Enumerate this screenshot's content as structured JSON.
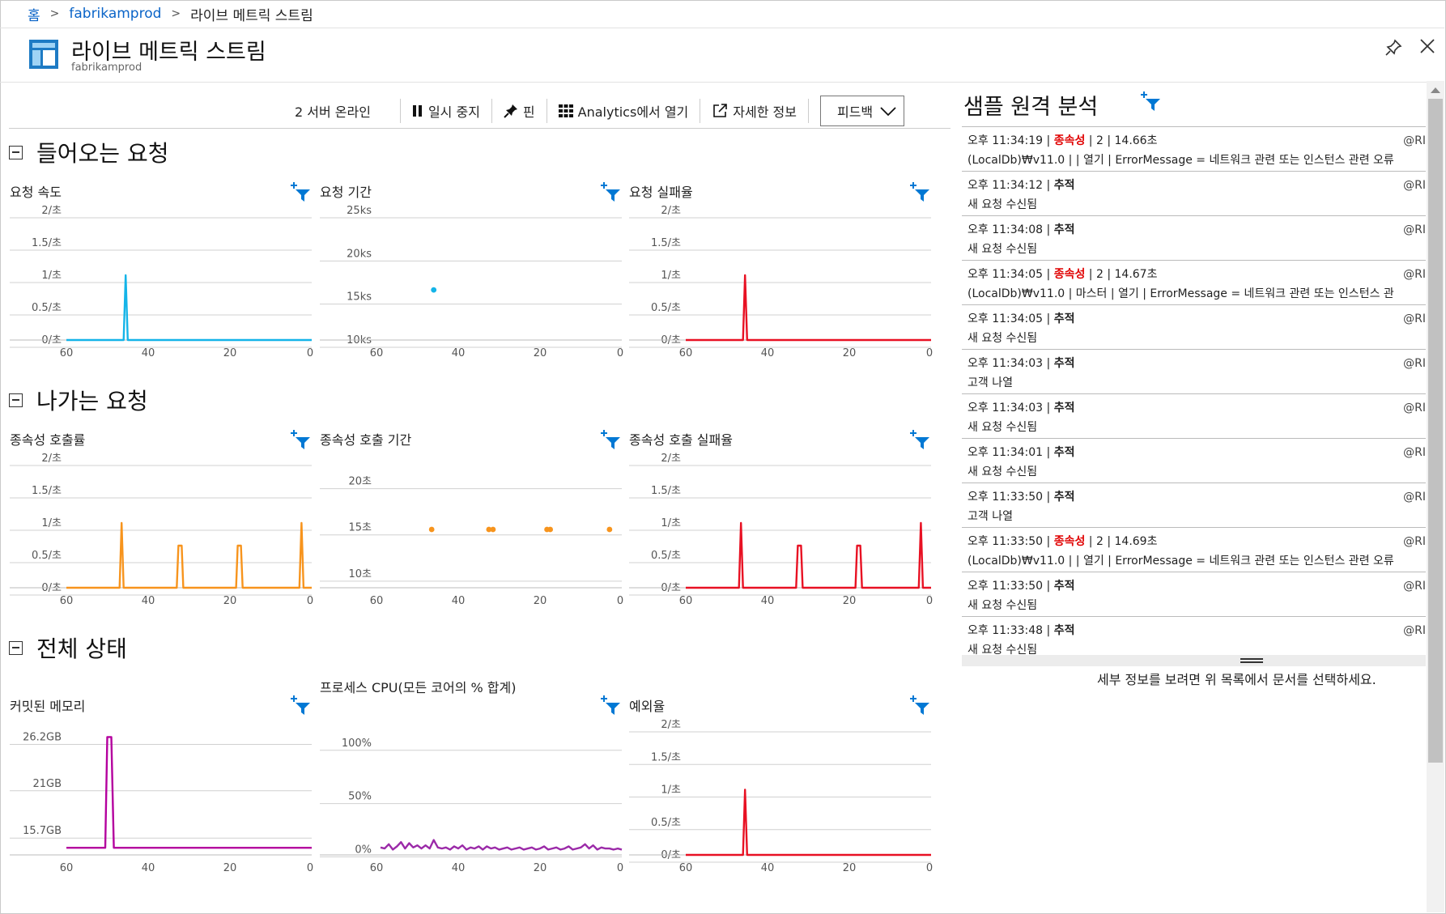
{
  "breadcrumb": {
    "home": "홈",
    "resource": "fabrikamprod",
    "current": "라이브 메트릭 스트림"
  },
  "header": {
    "title": "라이브 메트릭 스트림",
    "subtitle": "fabrikamprod"
  },
  "toolbar": {
    "servers": "2 서버 온라인",
    "pause": "일시 중지",
    "pin": "핀",
    "analytics": "Analytics에서 열기",
    "details": "자세한 정보",
    "feedback": "피드백"
  },
  "sections": {
    "incoming": "들어오는 요청",
    "outgoing": "나가는 요청",
    "overall": "전체 상태"
  },
  "colors": {
    "blue": "#14b4e8",
    "red": "#e81123",
    "orange": "#f7941d",
    "magenta": "#b4009e",
    "purple": "#9b2aa8",
    "link": "#0a64c8",
    "filter_icon": "#0078d4"
  },
  "chart_data": [
    {
      "id": "req-rate",
      "type": "line",
      "title": "요청 속도",
      "xlabel": "",
      "ylabel": "",
      "x_ticks": [
        "60",
        "40",
        "20",
        "0"
      ],
      "y_ticks": [
        "2/초",
        "1.5/초",
        "1/초",
        "0.5/초",
        "0/초"
      ],
      "ylim": [
        0,
        2
      ],
      "xlim": [
        60,
        0
      ],
      "series": [
        {
          "color": "#14b4e8",
          "points": [
            [
              60,
              0
            ],
            [
              46,
              0
            ],
            [
              45.5,
              1
            ],
            [
              45,
              0
            ],
            [
              0,
              0
            ]
          ]
        }
      ]
    },
    {
      "id": "req-duration",
      "type": "scatter",
      "title": "요청 기간",
      "xlabel": "",
      "ylabel": "",
      "x_ticks": [
        "60",
        "40",
        "20",
        "0"
      ],
      "y_ticks": [
        "25ks",
        "20ks",
        "15ks",
        "10ks"
      ],
      "ylim": [
        10000,
        25000
      ],
      "xlim": [
        60,
        0
      ],
      "series": [
        {
          "color": "#14b4e8",
          "points": [
            [
              46,
              15800
            ]
          ]
        }
      ]
    },
    {
      "id": "req-fail",
      "type": "line",
      "title": "요청 실패율",
      "xlabel": "",
      "ylabel": "",
      "x_ticks": [
        "60",
        "40",
        "20",
        "0"
      ],
      "y_ticks": [
        "2/초",
        "1.5/초",
        "1/초",
        "0.5/초",
        "0/초"
      ],
      "ylim": [
        0,
        2
      ],
      "xlim": [
        60,
        0
      ],
      "series": [
        {
          "color": "#e81123",
          "points": [
            [
              60,
              0
            ],
            [
              46,
              0
            ],
            [
              45.5,
              1
            ],
            [
              45,
              0
            ],
            [
              0,
              0
            ]
          ]
        }
      ]
    },
    {
      "id": "dep-rate",
      "type": "line",
      "title": "종속성 호출률",
      "xlabel": "",
      "ylabel": "",
      "x_ticks": [
        "60",
        "40",
        "20",
        "0"
      ],
      "y_ticks": [
        "2/초",
        "1.5/초",
        "1/초",
        "0.5/초",
        "0/초"
      ],
      "ylim": [
        0,
        2
      ],
      "xlim": [
        60,
        0
      ],
      "series": [
        {
          "color": "#f7941d",
          "points": [
            [
              60,
              0
            ],
            [
              47,
              0
            ],
            [
              46.5,
              1
            ],
            [
              46,
              0
            ],
            [
              33,
              0
            ],
            [
              32.6,
              0.65
            ],
            [
              31.8,
              0.65
            ],
            [
              31.4,
              0
            ],
            [
              18.5,
              0
            ],
            [
              18.1,
              0.65
            ],
            [
              17.3,
              0.65
            ],
            [
              16.9,
              0
            ],
            [
              3,
              0
            ],
            [
              2.5,
              1
            ],
            [
              2,
              0
            ],
            [
              0,
              0
            ]
          ]
        }
      ]
    },
    {
      "id": "dep-duration",
      "type": "scatter",
      "title": "종속성 호출 기간",
      "xlabel": "",
      "ylabel": "",
      "x_ticks": [
        "60",
        "40",
        "20",
        "0"
      ],
      "y_ticks": [
        "20초",
        "15초",
        "10초"
      ],
      "ylim": [
        8.5,
        22.5
      ],
      "xlim": [
        60,
        0
      ],
      "series": [
        {
          "color": "#f7941d",
          "points": [
            [
              46.5,
              14.8
            ],
            [
              32.5,
              14.8
            ],
            [
              31.5,
              14.8
            ],
            [
              18.3,
              14.8
            ],
            [
              17.5,
              14.8
            ],
            [
              3,
              14.8
            ]
          ]
        }
      ]
    },
    {
      "id": "dep-fail",
      "type": "line",
      "title": "종속성 호출 실패율",
      "xlabel": "",
      "ylabel": "",
      "x_ticks": [
        "60",
        "40",
        "20",
        "0"
      ],
      "y_ticks": [
        "2/초",
        "1.5/초",
        "1/초",
        "0.5/초",
        "0/초"
      ],
      "ylim": [
        0,
        2
      ],
      "xlim": [
        60,
        0
      ],
      "series": [
        {
          "color": "#e81123",
          "points": [
            [
              60,
              0
            ],
            [
              47,
              0
            ],
            [
              46.5,
              1
            ],
            [
              46,
              0
            ],
            [
              33,
              0
            ],
            [
              32.6,
              0.65
            ],
            [
              31.8,
              0.65
            ],
            [
              31.4,
              0
            ],
            [
              18.5,
              0
            ],
            [
              18.1,
              0.65
            ],
            [
              17.3,
              0.65
            ],
            [
              16.9,
              0
            ],
            [
              3,
              0
            ],
            [
              2.5,
              1
            ],
            [
              2,
              0
            ],
            [
              0,
              0
            ]
          ]
        }
      ]
    },
    {
      "id": "memory",
      "type": "line",
      "title": "커밋된 메모리",
      "xlabel": "",
      "ylabel": "",
      "x_ticks": [
        "60",
        "40",
        "20",
        "0"
      ],
      "y_ticks": [
        "26.2GB",
        "21GB",
        "15.7GB"
      ],
      "ylim": [
        13000,
        27600
      ],
      "xlim": [
        60,
        0
      ],
      "series": [
        {
          "color": "#b4009e",
          "points": [
            [
              60,
              13800
            ],
            [
              50.5,
              13800
            ],
            [
              50,
              26200
            ],
            [
              49,
              26200
            ],
            [
              48.4,
              13800
            ],
            [
              0,
              13800
            ]
          ]
        }
      ]
    },
    {
      "id": "cpu",
      "type": "line",
      "title": "프로세스 CPU(모든 코어의 % 합계)",
      "xlabel": "",
      "ylabel": "",
      "x_ticks": [
        "60",
        "40",
        "20",
        "0"
      ],
      "y_ticks": [
        "100%",
        "50%",
        "0%"
      ],
      "ylim": [
        -5,
        115
      ],
      "xlim": [
        60,
        0
      ],
      "series": [
        {
          "color": "#9b2aa8",
          "points": [
            [
              59,
              2
            ],
            [
              58,
              1
            ],
            [
              57,
              5
            ],
            [
              56,
              0
            ],
            [
              55,
              3
            ],
            [
              54,
              7
            ],
            [
              53,
              1
            ],
            [
              52,
              6
            ],
            [
              51,
              2
            ],
            [
              50,
              4
            ],
            [
              49,
              1
            ],
            [
              48,
              4
            ],
            [
              47,
              1
            ],
            [
              46,
              9
            ],
            [
              45,
              2
            ],
            [
              44,
              1
            ],
            [
              43,
              2
            ],
            [
              42,
              0
            ],
            [
              41,
              3
            ],
            [
              40,
              1
            ],
            [
              39,
              4
            ],
            [
              38,
              0
            ],
            [
              37,
              2
            ],
            [
              36,
              1
            ],
            [
              35,
              3
            ],
            [
              34,
              0
            ],
            [
              33,
              3
            ],
            [
              32,
              1
            ],
            [
              31,
              2
            ],
            [
              30,
              0
            ],
            [
              29,
              1
            ],
            [
              28,
              2
            ],
            [
              27,
              0
            ],
            [
              26,
              1
            ],
            [
              25,
              2
            ],
            [
              24,
              0
            ],
            [
              23,
              1
            ],
            [
              22,
              2
            ],
            [
              21,
              0
            ],
            [
              20,
              1
            ],
            [
              19,
              3
            ],
            [
              18,
              0
            ],
            [
              17,
              1
            ],
            [
              16,
              2
            ],
            [
              15,
              0
            ],
            [
              14,
              1
            ],
            [
              13,
              3
            ],
            [
              12,
              0
            ],
            [
              11,
              1
            ],
            [
              10,
              2
            ],
            [
              9,
              5
            ],
            [
              8,
              1
            ],
            [
              7,
              4
            ],
            [
              6,
              0
            ],
            [
              5,
              2
            ],
            [
              4,
              1
            ],
            [
              3,
              1
            ],
            [
              2,
              0
            ],
            [
              1,
              1
            ],
            [
              0,
              0
            ]
          ]
        }
      ]
    },
    {
      "id": "exceptions",
      "type": "line",
      "title": "예외율",
      "xlabel": "",
      "ylabel": "",
      "x_ticks": [
        "60",
        "40",
        "20",
        "0"
      ],
      "y_ticks": [
        "2/초",
        "1.5/초",
        "1/초",
        "0.5/초",
        "0/초"
      ],
      "ylim": [
        0,
        2
      ],
      "xlim": [
        60,
        0
      ],
      "series": [
        {
          "color": "#e81123",
          "points": [
            [
              60,
              0
            ],
            [
              46,
              0
            ],
            [
              45.5,
              1
            ],
            [
              45,
              0
            ],
            [
              0,
              0
            ]
          ]
        }
      ]
    }
  ],
  "sample": {
    "title": "샘플 원격 분석",
    "hint": "세부 정보를 보려면 위 목록에서 문서를 선택하세요.",
    "items": [
      {
        "time": "오후 11:34:19 |",
        "type": "종속성",
        "rest": "| 2 | 14.66초",
        "detail": "(LocalDb)₩v11.0 | | 열기 | ErrorMessage = 네트워크 관련 또는 인스턴스 관련 오류",
        "at": "@RI"
      },
      {
        "time": "오후 11:34:12 |",
        "type": "추적",
        "rest": "",
        "detail": "새 요청 수신됨",
        "at": "@RI"
      },
      {
        "time": "오후 11:34:08 |",
        "type": "추적",
        "rest": "",
        "detail": "새 요청 수신됨",
        "at": "@RI"
      },
      {
        "time": "오후 11:34:05 |",
        "type": "종속성",
        "rest": "| 2 | 14.67초",
        "detail": "(LocalDb)₩v11.0 | 마스터 | 열기 | ErrorMessage = 네트워크 관련 또는 인스턴스 관",
        "at": "@RI"
      },
      {
        "time": "오후 11:34:05 |",
        "type": "추적",
        "rest": "",
        "detail": "새 요청 수신됨",
        "at": "@RI"
      },
      {
        "time": "오후 11:34:03 |",
        "type": "추적",
        "rest": "",
        "detail": "고객 나열",
        "at": "@RI"
      },
      {
        "time": "오후 11:34:03 |",
        "type": "추적",
        "rest": "",
        "detail": "새 요청 수신됨",
        "at": "@RI"
      },
      {
        "time": "오후 11:34:01 |",
        "type": "추적",
        "rest": "",
        "detail": "새 요청 수신됨",
        "at": "@RI"
      },
      {
        "time": "오후 11:33:50 |",
        "type": "추적",
        "rest": "",
        "detail": "고객 나열",
        "at": "@RI"
      },
      {
        "time": "오후 11:33:50 |",
        "type": "종속성",
        "rest": "| 2 | 14.69초",
        "detail": "(LocalDb)₩v11.0 | | 열기 | ErrorMessage = 네트워크 관련 또는 인스턴스 관련 오류",
        "at": "@RI"
      },
      {
        "time": "오후 11:33:50 |",
        "type": "추적",
        "rest": "",
        "detail": "새 요청 수신됨",
        "at": "@RI"
      },
      {
        "time": "오후 11:33:48 |",
        "type": "추적",
        "rest": "",
        "detail": "새 요청 수신됨",
        "at": "@RI"
      }
    ]
  }
}
